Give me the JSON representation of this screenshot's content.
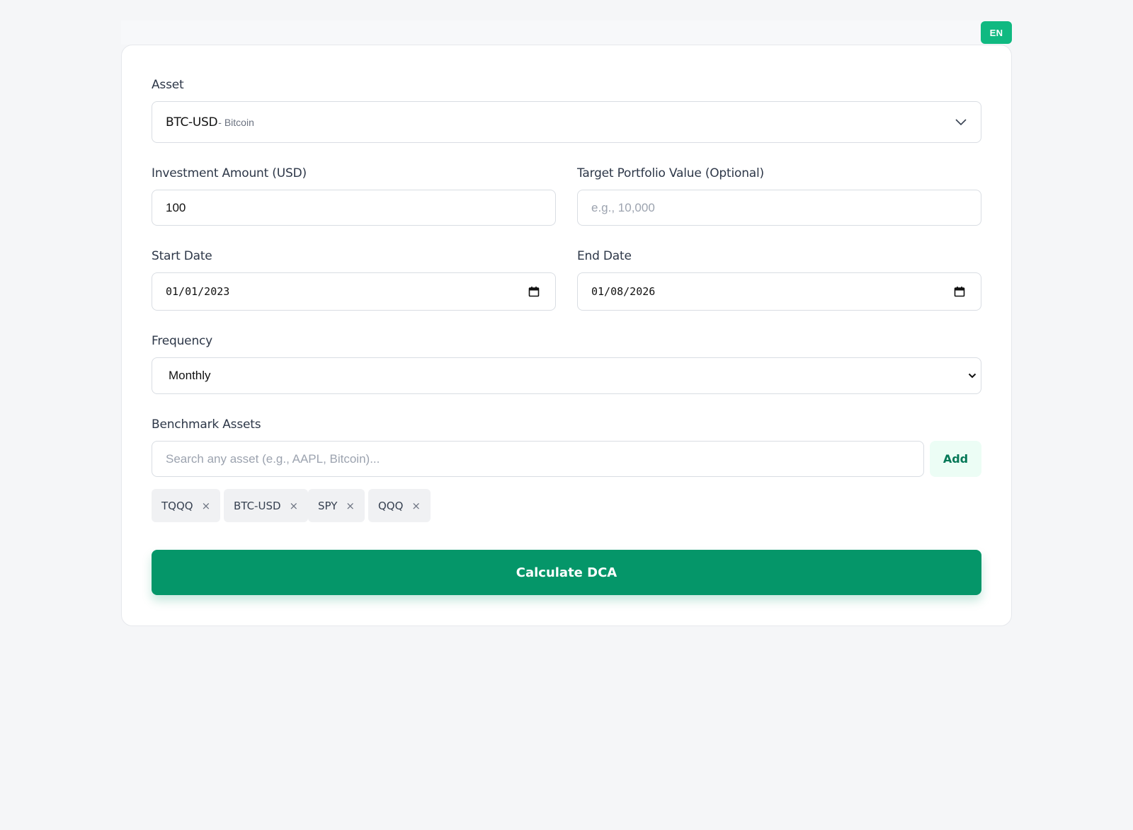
{
  "header": {
    "language_label": "EN"
  },
  "form": {
    "asset": {
      "label": "Asset",
      "ticker": "BTC-USD",
      "name": "- Bitcoin"
    },
    "investment_amount": {
      "label": "Investment Amount (USD)",
      "value": "100"
    },
    "target_value": {
      "label": "Target Portfolio Value (Optional)",
      "placeholder": "e.g., 10,000"
    },
    "start_date": {
      "label": "Start Date",
      "value": "01/01/2023"
    },
    "end_date": {
      "label": "End Date",
      "value": "01/08/2026"
    },
    "frequency": {
      "label": "Frequency",
      "value": "Monthly"
    },
    "benchmark": {
      "label": "Benchmark Assets",
      "placeholder": "Search any asset (e.g., AAPL, Bitcoin)...",
      "add_label": "Add",
      "chips": [
        "TQQQ",
        "BTC-USD",
        "SPY",
        "QQQ"
      ],
      "remove_glyph": "×"
    },
    "submit_label": "Calculate DCA"
  },
  "colors": {
    "accent": "#059669",
    "badge": "#10b981",
    "add_bg": "#ecfdf5"
  }
}
